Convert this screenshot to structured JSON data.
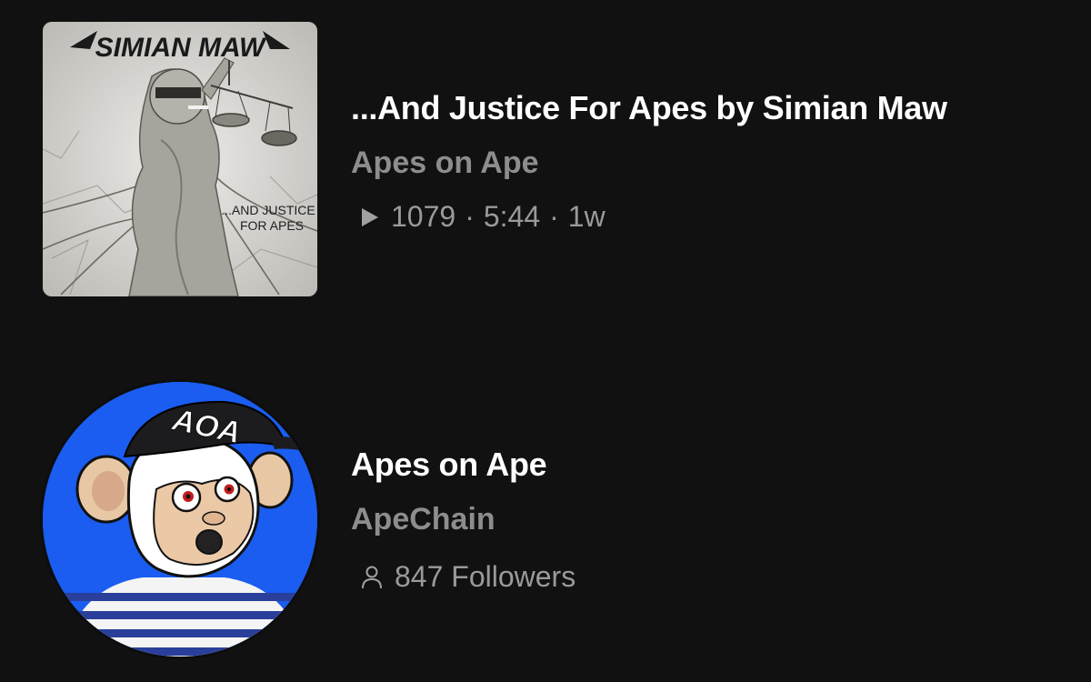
{
  "track": {
    "title": "...And Justice For Apes by Simian Maw",
    "channel": "Apes on Ape",
    "plays": "1079",
    "duration": "5:44",
    "age": "1w",
    "separator": "·",
    "artwork": {
      "band_logo": "SIMIAN MAW",
      "caption_line1": "...AND JUSTICE",
      "caption_line2": "FOR APES"
    },
    "icon": "play-icon"
  },
  "channel": {
    "name": "Apes on Ape",
    "network": "ApeChain",
    "followers": "847 Followers",
    "avatar": {
      "cap_text": "AOA",
      "background": "#1a5df0"
    },
    "icon": "user-icon"
  }
}
